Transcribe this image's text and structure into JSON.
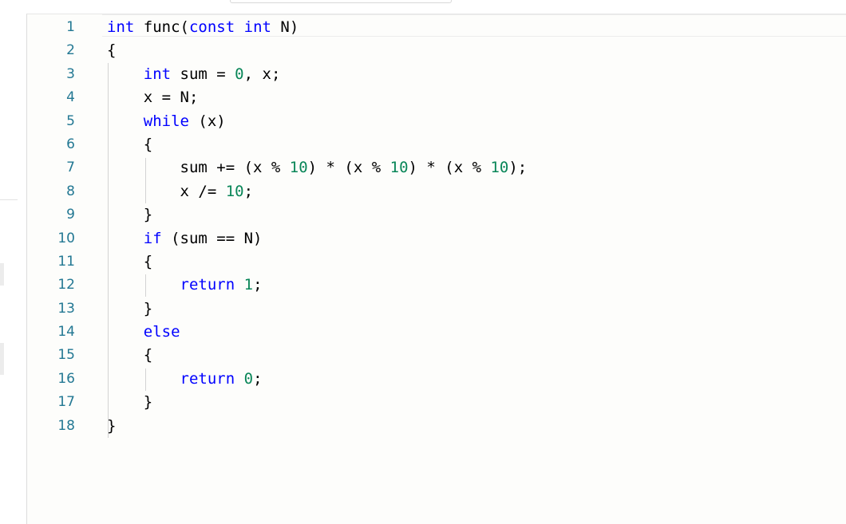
{
  "editor": {
    "line_numbers": [
      "1",
      "2",
      "3",
      "4",
      "5",
      "6",
      "7",
      "8",
      "9",
      "10",
      "11",
      "12",
      "13",
      "14",
      "15",
      "16",
      "17",
      "18"
    ],
    "colors": {
      "keyword": "#0000ff",
      "number": "#098658",
      "text": "#000000",
      "line_number": "#237893"
    },
    "lines": [
      [
        {
          "t": "int",
          "c": "kw"
        },
        {
          "t": " func(",
          "c": "p"
        },
        {
          "t": "const",
          "c": "kw"
        },
        {
          "t": " ",
          "c": "p"
        },
        {
          "t": "int",
          "c": "kw"
        },
        {
          "t": " N)",
          "c": "p"
        }
      ],
      [
        {
          "t": "{",
          "c": "p"
        }
      ],
      [
        {
          "t": "    ",
          "c": "p"
        },
        {
          "t": "int",
          "c": "kw"
        },
        {
          "t": " sum = ",
          "c": "p"
        },
        {
          "t": "0",
          "c": "num"
        },
        {
          "t": ", x;",
          "c": "p"
        }
      ],
      [
        {
          "t": "    x = N;",
          "c": "p"
        }
      ],
      [
        {
          "t": "    ",
          "c": "p"
        },
        {
          "t": "while",
          "c": "kw"
        },
        {
          "t": " (x)",
          "c": "p"
        }
      ],
      [
        {
          "t": "    {",
          "c": "p"
        }
      ],
      [
        {
          "t": "        sum += (x % ",
          "c": "p"
        },
        {
          "t": "10",
          "c": "num"
        },
        {
          "t": ") * (x % ",
          "c": "p"
        },
        {
          "t": "10",
          "c": "num"
        },
        {
          "t": ") * (x % ",
          "c": "p"
        },
        {
          "t": "10",
          "c": "num"
        },
        {
          "t": ");",
          "c": "p"
        }
      ],
      [
        {
          "t": "        x /= ",
          "c": "p"
        },
        {
          "t": "10",
          "c": "num"
        },
        {
          "t": ";",
          "c": "p"
        }
      ],
      [
        {
          "t": "    }",
          "c": "p"
        }
      ],
      [
        {
          "t": "    ",
          "c": "p"
        },
        {
          "t": "if",
          "c": "kw"
        },
        {
          "t": " (sum == N)",
          "c": "p"
        }
      ],
      [
        {
          "t": "    {",
          "c": "p"
        }
      ],
      [
        {
          "t": "        ",
          "c": "p"
        },
        {
          "t": "return",
          "c": "kw"
        },
        {
          "t": " ",
          "c": "p"
        },
        {
          "t": "1",
          "c": "num"
        },
        {
          "t": ";",
          "c": "p"
        }
      ],
      [
        {
          "t": "    }",
          "c": "p"
        }
      ],
      [
        {
          "t": "    ",
          "c": "p"
        },
        {
          "t": "else",
          "c": "kw"
        }
      ],
      [
        {
          "t": "    {",
          "c": "p"
        }
      ],
      [
        {
          "t": "        ",
          "c": "p"
        },
        {
          "t": "return",
          "c": "kw"
        },
        {
          "t": " ",
          "c": "p"
        },
        {
          "t": "0",
          "c": "num"
        },
        {
          "t": ";",
          "c": "p"
        }
      ],
      [
        {
          "t": "    }",
          "c": "p"
        }
      ],
      [
        {
          "t": "}",
          "c": "p"
        }
      ]
    ]
  }
}
